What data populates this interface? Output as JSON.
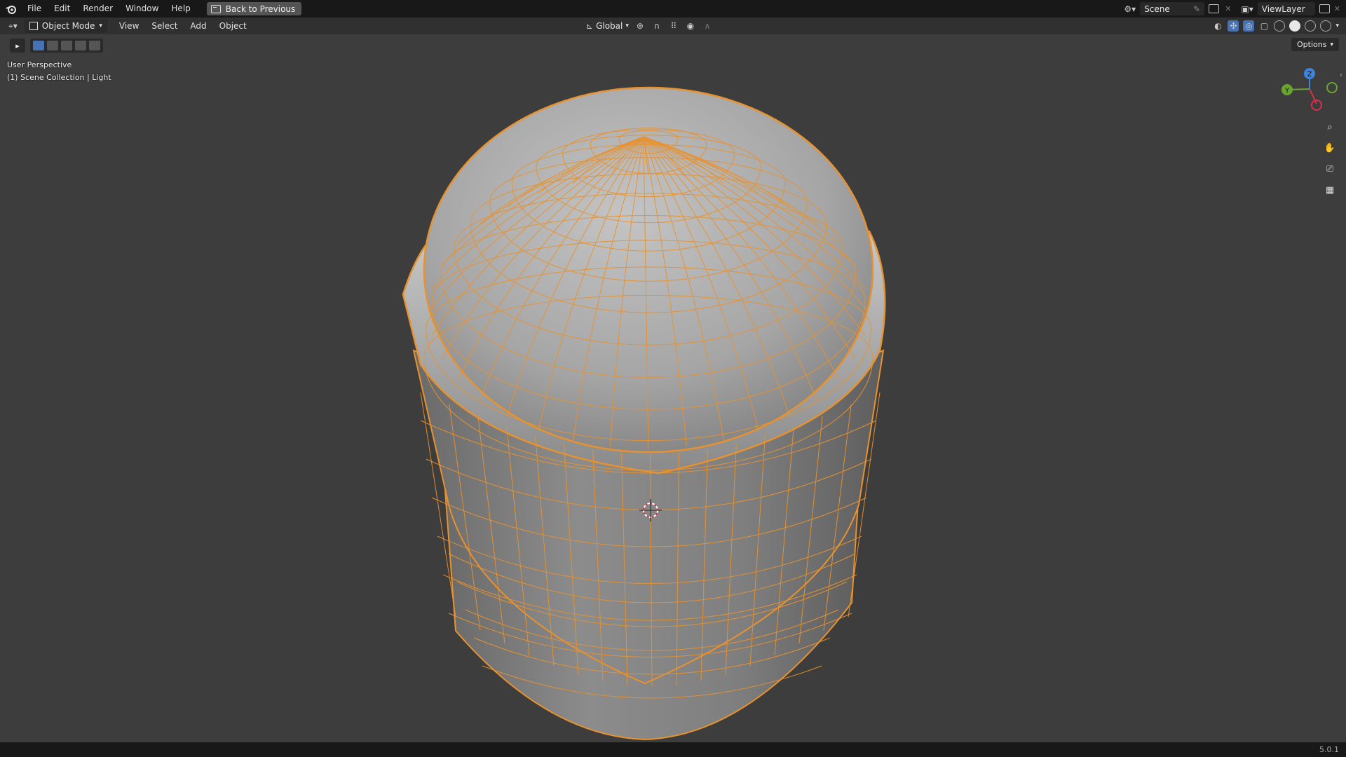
{
  "menubar": {
    "items": [
      "File",
      "Edit",
      "Render",
      "Window",
      "Help"
    ],
    "back_button": "Back to Previous",
    "scene": "Scene",
    "view_layer": "ViewLayer"
  },
  "header": {
    "mode": "Object Mode",
    "menus": [
      "View",
      "Select",
      "Add",
      "Object"
    ],
    "transform_orientation": "Global",
    "options": "Options"
  },
  "viewport": {
    "perspective_label": "User Perspective",
    "collection_label": "(1) Scene Collection | Light",
    "gizmo_axes": [
      "Z",
      "Y"
    ]
  },
  "status": {
    "version": "5.0.1"
  },
  "colors": {
    "wire": "#e8922f",
    "viewport_bg": "#3d3d3d",
    "axis_x": "#d9304a",
    "axis_y": "#6ba531",
    "axis_z": "#3d84e0"
  }
}
